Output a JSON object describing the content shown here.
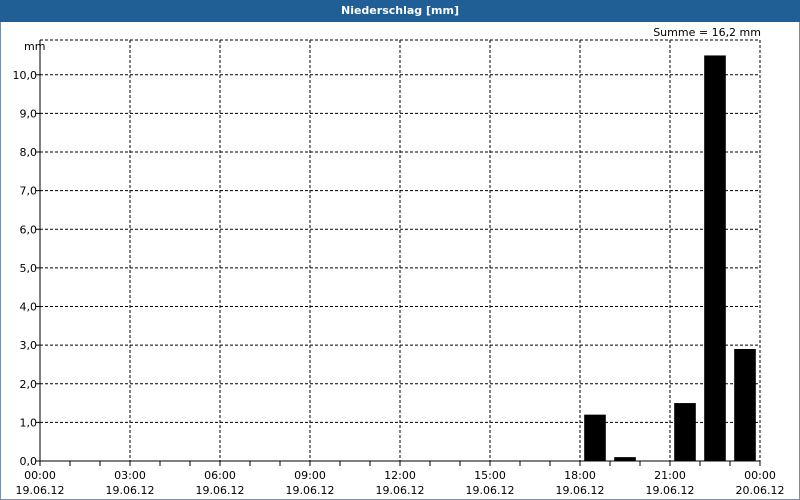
{
  "window": {
    "title": "Niederschlag [mm]"
  },
  "chart_data": {
    "type": "bar",
    "title": "Niederschlag [mm]",
    "ylabel": "mm",
    "xlabel": "",
    "ylim": [
      0,
      10.9
    ],
    "yticks": [
      0,
      1,
      2,
      3,
      4,
      5,
      6,
      7,
      8,
      9,
      10
    ],
    "ytick_labels": [
      "0,0",
      "1,0",
      "2,0",
      "3,0",
      "4,0",
      "5,0",
      "6,0",
      "7,0",
      "8,0",
      "9,0",
      "10,0"
    ],
    "xlim_hours": [
      0,
      24
    ],
    "xticks": [
      {
        "hour": 0,
        "time": "00:00",
        "date": "19.06.12"
      },
      {
        "hour": 3,
        "time": "03:00",
        "date": "19.06.12"
      },
      {
        "hour": 6,
        "time": "06:00",
        "date": "19.06.12"
      },
      {
        "hour": 9,
        "time": "09:00",
        "date": "19.06.12"
      },
      {
        "hour": 12,
        "time": "12:00",
        "date": "19.06.12"
      },
      {
        "hour": 15,
        "time": "15:00",
        "date": "19.06.12"
      },
      {
        "hour": 18,
        "time": "18:00",
        "date": "19.06.12"
      },
      {
        "hour": 21,
        "time": "21:00",
        "date": "19.06.12"
      },
      {
        "hour": 24,
        "time": "00:00",
        "date": "20.06.12"
      }
    ],
    "bars": [
      {
        "hour": 18.5,
        "value": 1.2
      },
      {
        "hour": 19.5,
        "value": 0.1
      },
      {
        "hour": 20.5,
        "value": 0.0
      },
      {
        "hour": 21.5,
        "value": 1.5
      },
      {
        "hour": 22.5,
        "value": 10.5
      },
      {
        "hour": 23.5,
        "value": 2.9
      }
    ],
    "annotation": "Summe = 16,2 mm",
    "grid": true,
    "colors": {
      "bar": "#000000",
      "titlebar": "#1f5f96",
      "grid": "#000000"
    }
  }
}
